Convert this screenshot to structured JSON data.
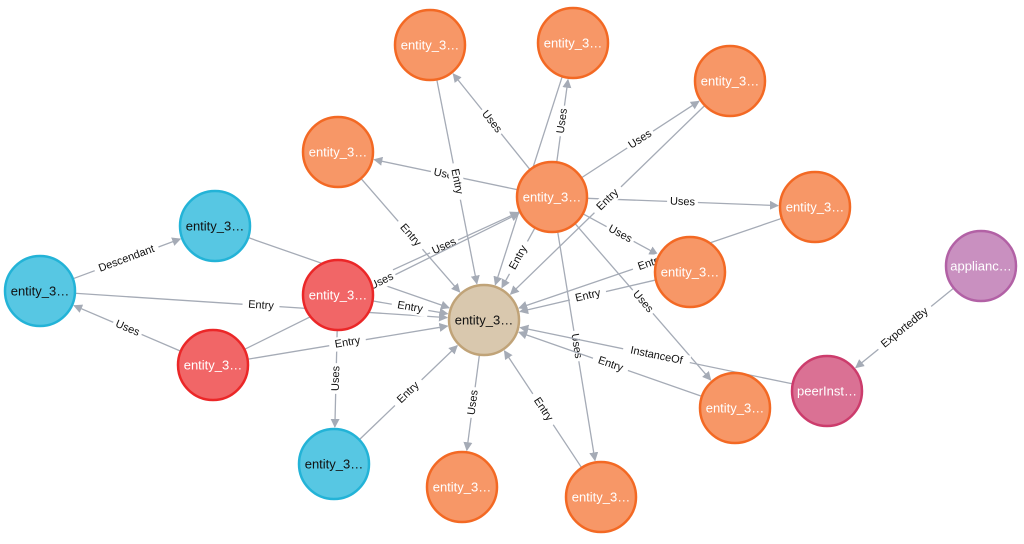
{
  "graph": {
    "node_styles": {
      "orange": {
        "fill": "#f79767",
        "stroke": "#f36924",
        "text": "#ffffff"
      },
      "blue": {
        "fill": "#57c7e3",
        "stroke": "#23b3d7",
        "text": "#111111"
      },
      "red": {
        "fill": "#f16667",
        "stroke": "#eb2728",
        "text": "#ffffff"
      },
      "beige": {
        "fill": "#d9c8ae",
        "stroke": "#c0a378",
        "text": "#111111"
      },
      "pink": {
        "fill": "#da7194",
        "stroke": "#cc3c6c",
        "text": "#ffffff"
      },
      "purple": {
        "fill": "#c990c0",
        "stroke": "#b261a5",
        "text": "#ffffff"
      }
    },
    "edge_color": "#a5abb6",
    "nodes": [
      {
        "id": "center",
        "label": "entity_3…",
        "style": "beige"
      },
      {
        "id": "hub",
        "label": "entity_3…",
        "style": "orange"
      },
      {
        "id": "o_top1",
        "label": "entity_3…",
        "style": "orange"
      },
      {
        "id": "o_top2",
        "label": "entity_3…",
        "style": "orange"
      },
      {
        "id": "o_top3",
        "label": "entity_3…",
        "style": "orange"
      },
      {
        "id": "o_left",
        "label": "entity_3…",
        "style": "orange"
      },
      {
        "id": "o_right1",
        "label": "entity_3…",
        "style": "orange"
      },
      {
        "id": "o_right2",
        "label": "entity_3…",
        "style": "orange"
      },
      {
        "id": "o_low1",
        "label": "entity_3…",
        "style": "orange"
      },
      {
        "id": "o_bot1",
        "label": "entity_3…",
        "style": "orange"
      },
      {
        "id": "o_bot2",
        "label": "entity_3…",
        "style": "orange"
      },
      {
        "id": "b_top",
        "label": "entity_3…",
        "style": "blue"
      },
      {
        "id": "b_left",
        "label": "entity_3…",
        "style": "blue"
      },
      {
        "id": "b_bot",
        "label": "entity_3…",
        "style": "blue"
      },
      {
        "id": "r_top",
        "label": "entity_3…",
        "style": "red"
      },
      {
        "id": "r_bot",
        "label": "entity_3…",
        "style": "red"
      },
      {
        "id": "peer",
        "label": "peerInst…",
        "style": "pink"
      },
      {
        "id": "appliance",
        "label": "applianc…",
        "style": "purple"
      }
    ],
    "edges": [
      {
        "from": "hub",
        "to": "o_top1",
        "label": "Uses"
      },
      {
        "from": "hub",
        "to": "o_top2",
        "label": "Uses"
      },
      {
        "from": "hub",
        "to": "o_top3",
        "label": "Uses"
      },
      {
        "from": "hub",
        "to": "o_left",
        "label": "Uses"
      },
      {
        "from": "hub",
        "to": "o_right1",
        "label": "Uses"
      },
      {
        "from": "hub",
        "to": "o_right2",
        "label": "Uses"
      },
      {
        "from": "hub",
        "to": "o_low1",
        "label": "Uses"
      },
      {
        "from": "hub",
        "to": "o_bot2",
        "label": "Uses"
      },
      {
        "from": "hub",
        "to": "center",
        "label": "Entry"
      },
      {
        "from": "o_top1",
        "to": "center",
        "label": "Entry"
      },
      {
        "from": "o_top2",
        "to": "center",
        "label": ""
      },
      {
        "from": "o_top3",
        "to": "center",
        "label": "Entry"
      },
      {
        "from": "o_left",
        "to": "center",
        "label": "Entry"
      },
      {
        "from": "o_right1",
        "to": "center",
        "label": "Entry"
      },
      {
        "from": "o_right2",
        "to": "center",
        "label": "Entry"
      },
      {
        "from": "o_low1",
        "to": "center",
        "label": "Entry"
      },
      {
        "from": "o_bot2",
        "to": "center",
        "label": "Entry"
      },
      {
        "from": "center",
        "to": "o_bot1",
        "label": "Uses"
      },
      {
        "from": "b_top",
        "to": "center",
        "label": ""
      },
      {
        "from": "b_left",
        "to": "b_top",
        "label": "Descendant"
      },
      {
        "from": "b_left",
        "to": "center",
        "label": "Entry"
      },
      {
        "from": "b_bot",
        "to": "center",
        "label": "Entry"
      },
      {
        "from": "r_top",
        "to": "center",
        "label": "Entry"
      },
      {
        "from": "r_top",
        "to": "hub",
        "label": "Uses"
      },
      {
        "from": "r_top",
        "to": "b_bot",
        "label": "Uses"
      },
      {
        "from": "r_bot",
        "to": "b_left",
        "label": "Uses"
      },
      {
        "from": "r_bot",
        "to": "center",
        "label": "Entry"
      },
      {
        "from": "r_bot",
        "to": "hub",
        "label": "Uses"
      },
      {
        "from": "peer",
        "to": "center",
        "label": "InstanceOf"
      },
      {
        "from": "appliance",
        "to": "peer",
        "label": "ExportedBy"
      }
    ]
  }
}
